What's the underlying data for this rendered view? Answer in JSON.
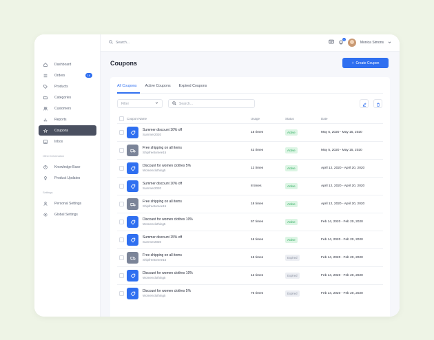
{
  "header": {
    "search_placeholder": "Search...",
    "user_name": "Monica Simons",
    "notification_count": "3"
  },
  "sidebar": {
    "items": [
      {
        "label": "Dashboard",
        "icon": "home-icon"
      },
      {
        "label": "Orders",
        "icon": "list-icon",
        "badge": "16"
      },
      {
        "label": "Products",
        "icon": "tag-icon"
      },
      {
        "label": "Categories",
        "icon": "folder-icon"
      },
      {
        "label": "Customers",
        "icon": "users-icon"
      },
      {
        "label": "Reports",
        "icon": "bar-chart-icon"
      },
      {
        "label": "Coupons",
        "icon": "star-icon",
        "active": true
      },
      {
        "label": "Inbox",
        "icon": "inbox-icon"
      }
    ],
    "section_other": "Other Information",
    "other_items": [
      {
        "label": "Knowledge Base",
        "icon": "help-icon"
      },
      {
        "label": "Product Updates",
        "icon": "bulb-icon"
      }
    ],
    "section_settings": "Settings",
    "settings_items": [
      {
        "label": "Personal Settings",
        "icon": "user-icon"
      },
      {
        "label": "Global Settings",
        "icon": "gear-icon"
      }
    ]
  },
  "page": {
    "title": "Coupons",
    "create_button": "Create Coupon",
    "tabs": [
      "All Coupons",
      "Active Coupons",
      "Expired Coupons"
    ],
    "filter_label": "Filter",
    "search_placeholder": "Search...",
    "columns": {
      "name": "Coupon Name",
      "usage": "Usage",
      "status": "Status",
      "date": "Date"
    }
  },
  "coupons": [
    {
      "name": "Summer discount 10% off",
      "code": "Summer2020",
      "usage": "15 times",
      "status": "Active",
      "date": "May 5, 2020 - May 15, 2020",
      "kind": "tag"
    },
    {
      "name": "Free shipping on all items",
      "code": "Shipfreetomee15",
      "usage": "42 times",
      "status": "Active",
      "date": "May 5, 2020 - May 15, 2020",
      "kind": "truck"
    },
    {
      "name": "Discount for women clothes 5%",
      "code": "Womenclothing5",
      "usage": "12 times",
      "status": "Active",
      "date": "April 12, 2020 - April 20, 2020",
      "kind": "tag"
    },
    {
      "name": "Summer discount 10% off",
      "code": "Summer2020",
      "usage": "8 times",
      "status": "Active",
      "date": "April 12, 2020 - April 20, 2020",
      "kind": "tag"
    },
    {
      "name": "Free shipping on all items",
      "code": "Shipfreetomee15",
      "usage": "18 times",
      "status": "Active",
      "date": "April 12, 2020 - April 20, 2020",
      "kind": "truck"
    },
    {
      "name": "Discount for women clothes 10%",
      "code": "Womenclothing5",
      "usage": "57 times",
      "status": "Active",
      "date": "Feb 14, 2020 - Feb 20, 2020",
      "kind": "tag"
    },
    {
      "name": "Summer discount 15% off",
      "code": "Summer2020",
      "usage": "16 times",
      "status": "Active",
      "date": "Feb 14, 2020 - Feb 20, 2020",
      "kind": "tag"
    },
    {
      "name": "Free shipping on all items",
      "code": "Shipfreetomee15",
      "usage": "15 times",
      "status": "Expired",
      "date": "Feb 14, 2020 - Feb 20, 2020",
      "kind": "truck"
    },
    {
      "name": "Discount for women clothes 10%",
      "code": "Womenclothing5",
      "usage": "12 times",
      "status": "Expired",
      "date": "Feb 14, 2020 - Feb 20, 2020",
      "kind": "tag"
    },
    {
      "name": "Discount for women clothes 5%",
      "code": "Womenclothing5",
      "usage": "76 times",
      "status": "Expired",
      "date": "Feb 14, 2020 - Feb 20, 2020",
      "kind": "tag"
    }
  ],
  "colors": {
    "accent": "#2f6ff0",
    "active_bg": "#dcf5e4",
    "active_text": "#28a95a",
    "expired_bg": "#eceef3",
    "tag_icon_bg": "#2f6ff0",
    "truck_icon_bg": "#7b8498"
  }
}
